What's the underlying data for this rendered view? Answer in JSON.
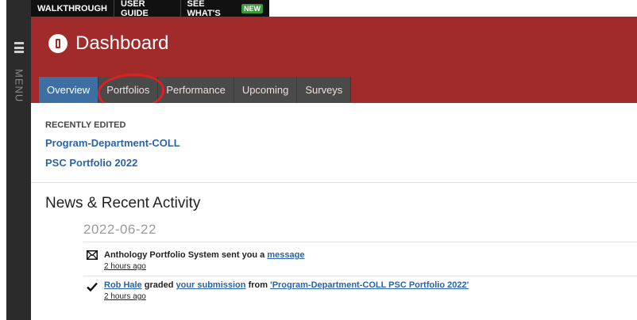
{
  "menu": {
    "label": "MENU"
  },
  "toolbar": {
    "walkthrough": "WALKTHROUGH",
    "user_guide": "USER GUIDE",
    "whats_new": "SEE WHAT'S",
    "new_badge": "NEW"
  },
  "header": {
    "title": "Dashboard"
  },
  "tabs": [
    {
      "label": "Overview",
      "active": true
    },
    {
      "label": "Portfolios",
      "active": false
    },
    {
      "label": "Performance",
      "active": false
    },
    {
      "label": "Upcoming",
      "active": false
    },
    {
      "label": "Surveys",
      "active": false
    }
  ],
  "recent": {
    "heading": "RECENTLY EDITED",
    "items": [
      "Program-Department-COLL",
      "PSC Portfolio 2022"
    ]
  },
  "news": {
    "title": "News & Recent Activity",
    "date": "2022-06-22",
    "activities": [
      {
        "icon": "envelope-icon",
        "actor": "Anthology Portfolio System",
        "verb": " sent you a ",
        "link": "message",
        "time": "2 hours ago"
      },
      {
        "icon": "checkmark-icon",
        "actor_link": "Rob Hale",
        "verb": " graded ",
        "link": "your submission",
        "from": " from ",
        "target_link": "'Program-Department-COLL PSC Portfolio 2022'",
        "time": "2 hours ago"
      }
    ]
  },
  "colors": {
    "header_red": "#a12b2b",
    "tab_active": "#3d6fa3",
    "link_blue": "#2a63a8",
    "annotation_circle": "#e02020"
  }
}
